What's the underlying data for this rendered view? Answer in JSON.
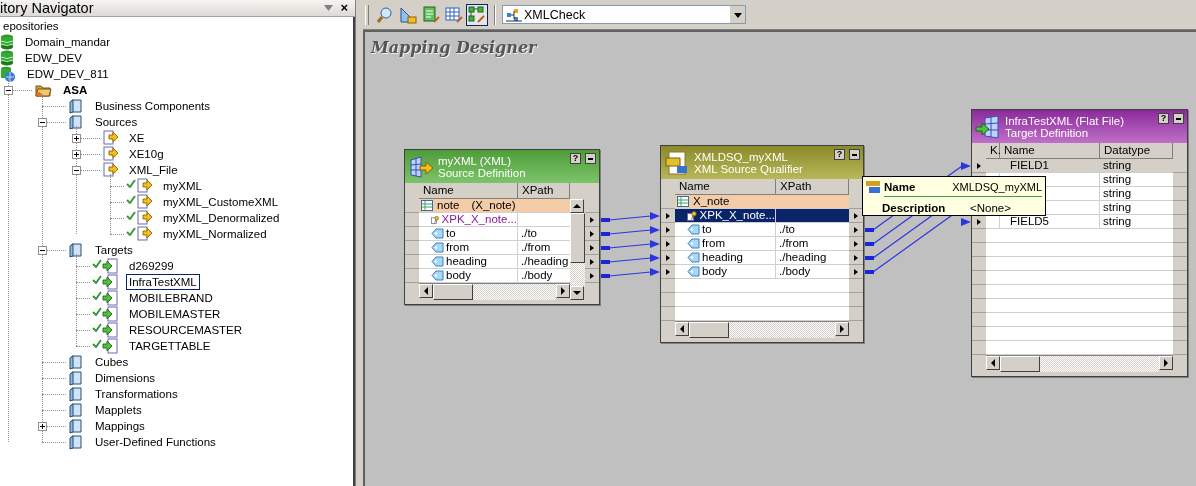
{
  "navigator": {
    "title": "itory Navigator",
    "close": "×"
  },
  "tree": [
    {
      "label": "epositories",
      "selected": false,
      "children": [
        {
          "label": "Domain_mandar",
          "kind": "repository",
          "selected": false
        },
        {
          "label": "EDW_DEV",
          "kind": "repository",
          "selected": false
        },
        {
          "label": "EDW_DEV_811",
          "kind": "repository-connected",
          "selected": false,
          "children": [
            {
              "label": "ASA",
              "kind": "folder-open",
              "bold": true,
              "expanded": true,
              "selected": false,
              "children": [
                {
                  "label": "Business Components",
                  "kind": "folder",
                  "selected": false
                },
                {
                  "label": "Sources",
                  "kind": "folder",
                  "expanded": true,
                  "selected": false,
                  "children": [
                    {
                      "label": "XE",
                      "kind": "source-group",
                      "expanded": false,
                      "selected": false
                    },
                    {
                      "label": "XE10g",
                      "kind": "source-group",
                      "expanded": false,
                      "selected": false
                    },
                    {
                      "label": "XML_File",
                      "kind": "source-group",
                      "expanded": true,
                      "selected": false,
                      "children": [
                        {
                          "label": "myXML",
                          "kind": "source",
                          "valid": true,
                          "selected": false
                        },
                        {
                          "label": "myXML_CustomeXML",
                          "kind": "source",
                          "valid": true,
                          "selected": false
                        },
                        {
                          "label": "myXML_Denormalized",
                          "kind": "source",
                          "valid": true,
                          "selected": false
                        },
                        {
                          "label": "myXML_Normalized",
                          "kind": "source",
                          "valid": true,
                          "selected": false
                        }
                      ]
                    }
                  ]
                },
                {
                  "label": "Targets",
                  "kind": "folder",
                  "expanded": true,
                  "selected": false,
                  "children": [
                    {
                      "label": "d269299",
                      "kind": "target",
                      "valid": true,
                      "selected": false
                    },
                    {
                      "label": "InfraTestXML",
                      "kind": "target",
                      "valid": true,
                      "selected": true
                    },
                    {
                      "label": "MOBILEBRAND",
                      "kind": "target",
                      "valid": true,
                      "selected": false
                    },
                    {
                      "label": "MOBILEMASTER",
                      "kind": "target",
                      "valid": true,
                      "selected": false
                    },
                    {
                      "label": "RESOURCEMASTER",
                      "kind": "target",
                      "valid": true,
                      "selected": false
                    },
                    {
                      "label": "TARGETTABLE",
                      "kind": "target",
                      "valid": true,
                      "selected": false
                    }
                  ]
                },
                {
                  "label": "Cubes",
                  "kind": "folder",
                  "selected": false
                },
                {
                  "label": "Dimensions",
                  "kind": "folder",
                  "selected": false
                },
                {
                  "label": "Transformations",
                  "kind": "folder",
                  "selected": false
                },
                {
                  "label": "Mapplets",
                  "kind": "folder",
                  "selected": false
                },
                {
                  "label": "Mappings",
                  "kind": "folder",
                  "expanded": false,
                  "selected": false
                },
                {
                  "label": "User-Defined Functions",
                  "kind": "folder",
                  "selected": false
                }
              ]
            }
          ]
        }
      ]
    }
  ],
  "toolbar": {
    "buttons": [
      {
        "kind": "find",
        "selected": false
      },
      {
        "kind": "layout",
        "selected": false
      },
      {
        "kind": "edit",
        "selected": false
      },
      {
        "kind": "table",
        "selected": false
      },
      {
        "kind": "mapping",
        "selected": true
      }
    ],
    "mapping_select": {
      "value": "XMLCheck"
    }
  },
  "canvas": {
    "title": "Mapping Designer"
  },
  "transformations": [
    {
      "kind": "source",
      "title": "myXML (XML)",
      "subtitle": "Source Definition",
      "help": "?",
      "columns": [
        "Name",
        "XPath"
      ],
      "rows": [
        {
          "kind": "group",
          "name": "note",
          "extra": "(X_note)",
          "selected": false
        },
        {
          "kind": "key",
          "name": "XPK_X_note...",
          "selected": false,
          "link_out": true
        },
        {
          "kind": "element",
          "name": "to",
          "xpath": "./to",
          "selected": false,
          "link_out": true
        },
        {
          "kind": "element",
          "name": "from",
          "xpath": "./from",
          "selected": false,
          "link_out": true
        },
        {
          "kind": "element",
          "name": "heading",
          "xpath": "./heading",
          "selected": false,
          "link_out": true
        },
        {
          "kind": "element",
          "name": "body",
          "xpath": "./body",
          "selected": false,
          "link_out": true
        }
      ]
    },
    {
      "kind": "qualifier",
      "title": "XMLDSQ_myXML",
      "subtitle": "XML Source Qualifier",
      "help": "?",
      "columns": [
        "Name",
        "XPath"
      ],
      "rows": [
        {
          "kind": "group",
          "name": "X_note",
          "selected": false
        },
        {
          "kind": "key",
          "name": "XPK_X_note...",
          "selected": true,
          "link_in": true,
          "link_out": false
        },
        {
          "kind": "element",
          "name": "to",
          "xpath": "./to",
          "selected": false,
          "link_in": true,
          "link_out": true
        },
        {
          "kind": "element",
          "name": "from",
          "xpath": "./from",
          "selected": false,
          "link_in": true,
          "link_out": true
        },
        {
          "kind": "element",
          "name": "heading",
          "xpath": "./heading",
          "selected": false,
          "link_in": true,
          "link_out": true
        },
        {
          "kind": "element",
          "name": "body",
          "xpath": "./body",
          "selected": false,
          "link_in": true,
          "link_out": true
        }
      ]
    },
    {
      "kind": "target",
      "title": "InfraTestXML (Flat File)",
      "subtitle": "Target Definition",
      "help": "?",
      "columns": [
        "K.",
        "Name",
        "Datatype"
      ],
      "rows": [
        {
          "kind": "field",
          "name": "FIELD1",
          "datatype": "string",
          "selected": true,
          "link_in": true
        },
        {
          "kind": "field",
          "datatype": "string",
          "selected": false
        },
        {
          "kind": "field",
          "datatype": "string",
          "selected": false
        },
        {
          "kind": "field",
          "datatype": "string",
          "selected": false
        },
        {
          "kind": "field",
          "name": "FIELD5",
          "datatype": "string",
          "selected": false,
          "link_in": true
        }
      ]
    }
  ],
  "tooltip": {
    "name_label": "Name",
    "name": "XMLDSQ_myXML",
    "description_label": "Description",
    "description": "<None>"
  }
}
